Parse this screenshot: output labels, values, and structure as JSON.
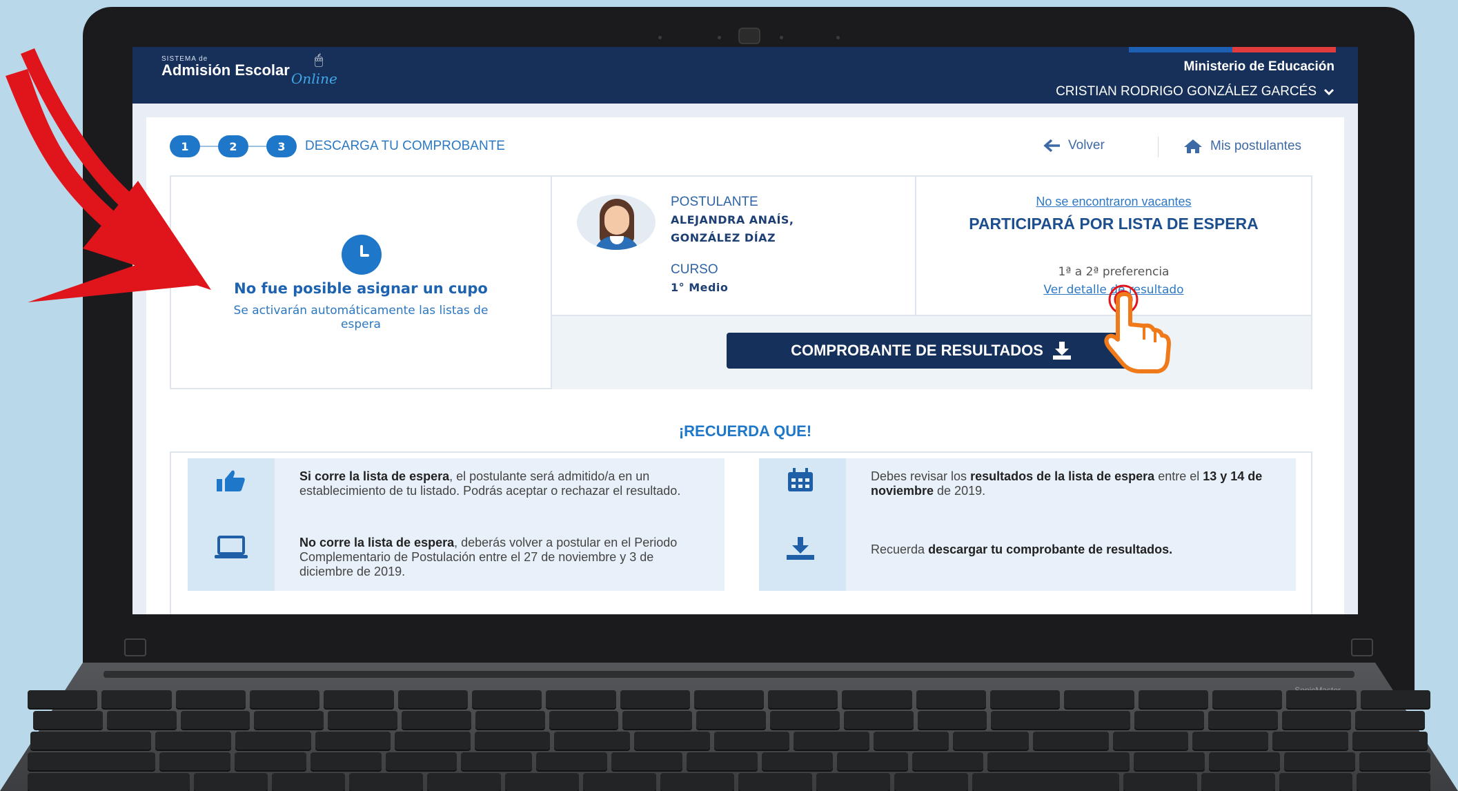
{
  "header": {
    "logo_small": "SISTEMA de",
    "logo_main": "Admisión Escolar",
    "logo_online": "Online",
    "ministry": "Ministerio de Educación",
    "user_name": "CRISTIAN RODRIGO GONZÁLEZ GARCÉS"
  },
  "stepper": {
    "steps": [
      "1",
      "2",
      "3"
    ],
    "label": "DESCARGA TU COMPROBANTE"
  },
  "nav": {
    "back": "Volver",
    "postulantes": "Mis postulantes"
  },
  "result": {
    "status_title": "No fue posible asignar un cupo",
    "status_sub": "Se activarán automáticamente las listas de espera",
    "applicant_label": "POSTULANTE",
    "applicant_name_1": "ALEJANDRA ANAÍS,",
    "applicant_name_2": "GONZÁLEZ DÍAZ",
    "course_label": "CURSO",
    "course_value": "1° Medio",
    "no_vacancies": "No se encontraron vacantes",
    "waitlist_title": "PARTICIPARÁ POR LISTA DE ESPERA",
    "preference": "1ª a 2ª preferencia",
    "detail_link": "Ver detalle de resultado",
    "download_button": "COMPROBANTE DE RESULTADOS"
  },
  "reminder": {
    "title": "¡RECUERDA QUE!",
    "item1_bold": "Si corre la lista de espera",
    "item1_rest": ", el postulante será admitido/a en un establecimiento de tu listado. Podrás aceptar o rechazar el resultado.",
    "item2_bold": "No corre la lista de espera",
    "item2_rest": ", deberás volver a postular en el Periodo Complementario de Postulación entre el 27 de noviembre y 3 de diciembre de 2019.",
    "item3_pre": "Debes revisar los ",
    "item3_bold1": "resultados de la lista de espera",
    "item3_mid": " entre el ",
    "item3_bold2": "13 y 14 de noviembre",
    "item3_post": " de 2019.",
    "item4_pre": "Recuerda ",
    "item4_bold": "descargar tu comprobante de resultados."
  },
  "laptop": {
    "brand": "SonicMaster"
  },
  "colors": {
    "header_bg": "#17305a",
    "accent_blue": "#1f77c9",
    "button_bg": "#16305c",
    "annotation_red": "#e0141b",
    "annotation_orange": "#f07a1a"
  },
  "icons": [
    "clock-icon",
    "arrow-left-icon",
    "home-icon",
    "download-icon",
    "thumbs-up-icon",
    "laptop-icon",
    "calendar-icon",
    "chevron-down-icon",
    "pointing-hand-icon",
    "red-arrow-icon"
  ]
}
